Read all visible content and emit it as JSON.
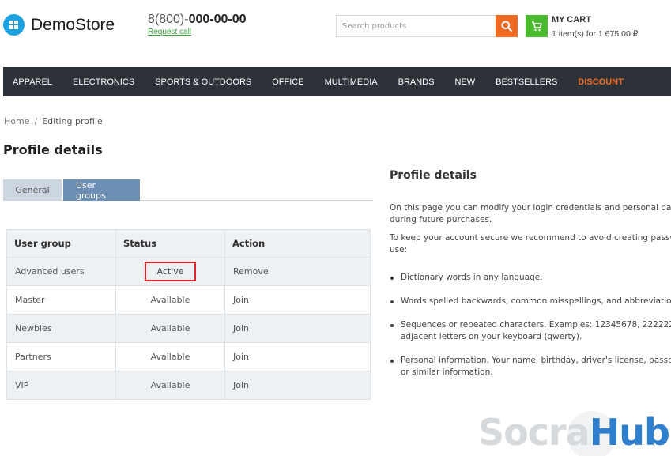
{
  "brand": {
    "name": "DemoStore",
    "color": "#19a1e1"
  },
  "contact": {
    "phone_prefix": "8(800)-",
    "phone_number": "000-00-00",
    "request_call": "Request call"
  },
  "search": {
    "placeholder": "Search products",
    "icon": "search-icon",
    "button_color": "#f06b21"
  },
  "cart": {
    "title": "MY CART",
    "summary": "1 item(s) for 1 675.00 ₽",
    "icon": "cart-icon",
    "color": "#4aba2f"
  },
  "nav": {
    "items": [
      {
        "label": "APPAREL"
      },
      {
        "label": "ELECTRONICS"
      },
      {
        "label": "SPORTS & OUTDOORS"
      },
      {
        "label": "OFFICE"
      },
      {
        "label": "MULTIMEDIA"
      },
      {
        "label": "BRANDS"
      },
      {
        "label": "NEW"
      },
      {
        "label": "BESTSELLERS"
      },
      {
        "label": "DISCOUNT"
      }
    ],
    "discount_color": "#f26a21"
  },
  "breadcrumb": {
    "home": "Home",
    "separator": "/",
    "current": "Editing profile"
  },
  "page": {
    "title": "Profile details"
  },
  "tabs": [
    {
      "label": "General",
      "active": false
    },
    {
      "label": "User groups",
      "active": true
    }
  ],
  "table": {
    "headers": [
      "User group",
      "Status",
      "Action"
    ],
    "rows": [
      {
        "group": "Advanced users",
        "status": "Active",
        "action": "Remove"
      },
      {
        "group": "Master",
        "status": "Available",
        "action": "Join"
      },
      {
        "group": "Newbies",
        "status": "Available",
        "action": "Join"
      },
      {
        "group": "Partners",
        "status": "Available",
        "action": "Join"
      },
      {
        "group": "VIP",
        "status": "Available",
        "action": "Join"
      }
    ],
    "highlight_color": "#e0222a"
  },
  "info": {
    "title": "Profile details",
    "paragraphs": [
      "On this page you can modify your login credentials and personal dat",
      "during future purchases.",
      "To keep your account secure we recommend to avoid creating passw",
      "use:"
    ],
    "bullets": [
      [
        "Dictionary words in any language."
      ],
      [
        "Words spelled backwards, common misspellings, and abbreviation"
      ],
      [
        "Sequences or repeated characters. Examples: 12345678, 222222, a",
        "adjacent letters on your keyboard (qwerty)."
      ],
      [
        "Personal information. Your name, birthday, driver's license, passp",
        "or similar information."
      ]
    ]
  },
  "watermark": {
    "part1": "Socra",
    "part2": "Hub"
  }
}
